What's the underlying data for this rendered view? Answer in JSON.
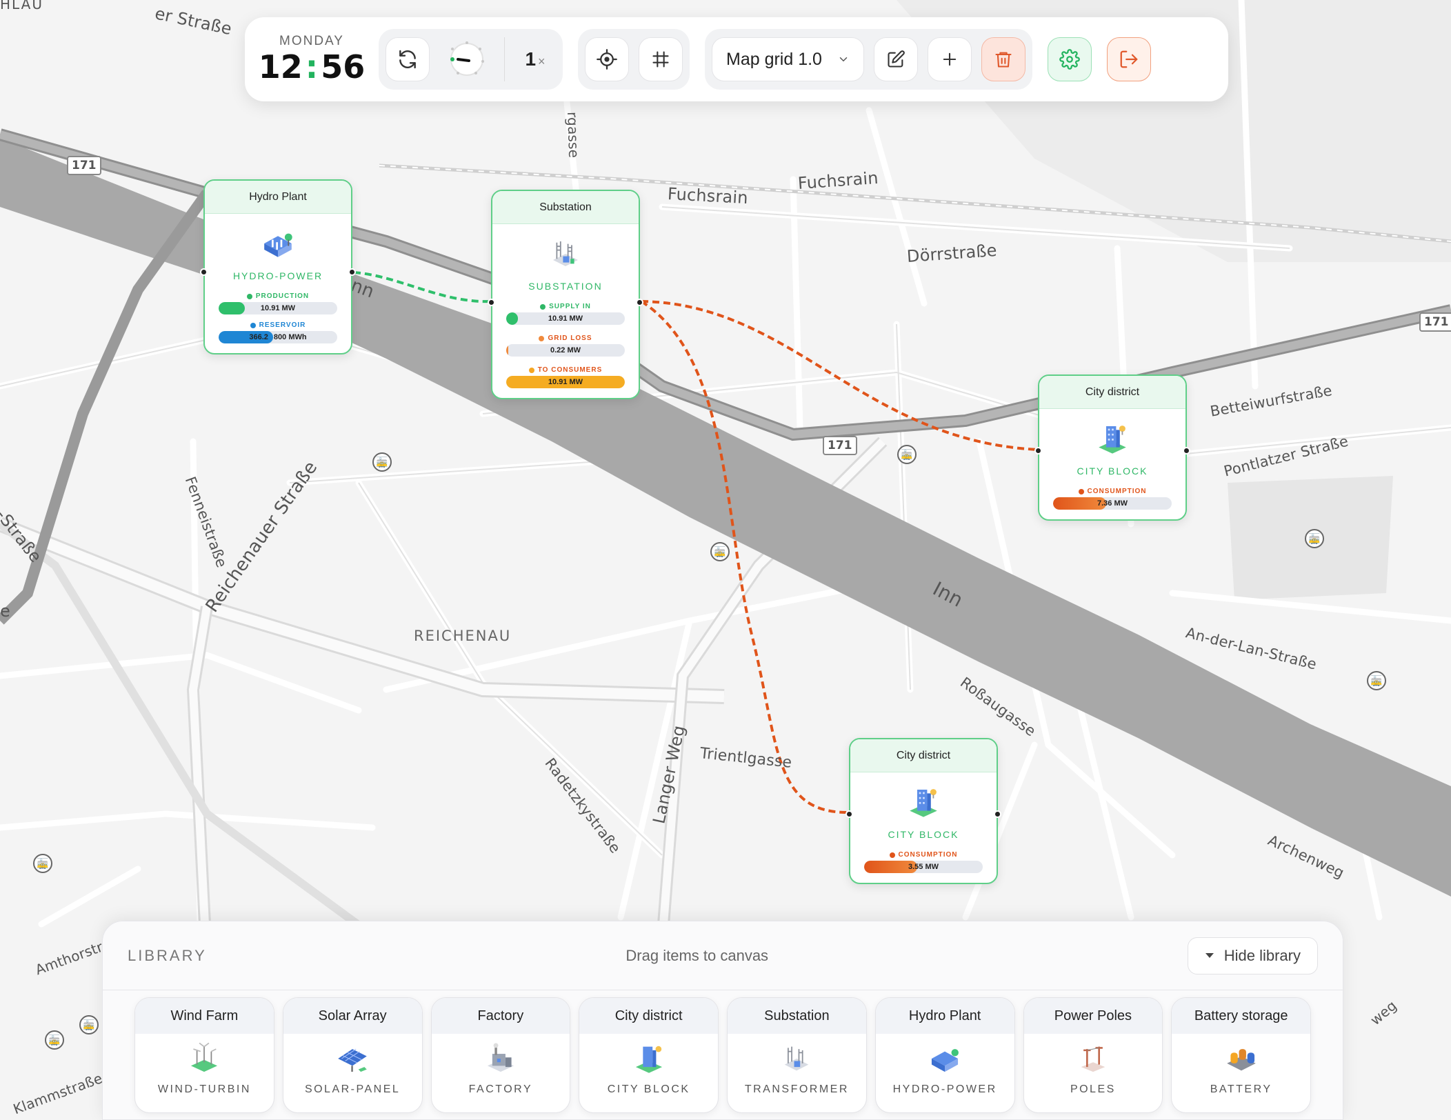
{
  "map": {
    "labels": {
      "reichenau": "REICHENAU",
      "inn": "Inn",
      "inn_small": "nn",
      "fuchsrain1": "Fuchsrain",
      "fuchsrain2": "Fuchsrain",
      "doerrstrasse": "Dörrstraße",
      "betteiwurfstrasse": "Betteiwurfstraße",
      "pontlatzer": "Pontlatzer Straße",
      "reichenauer": "Reichenauer Straße",
      "fenneistrasse": "Fenneistraße",
      "radetzky": "Radetzkystraße",
      "langerweg": "Langer Weg",
      "trientlgasse": "Trientlgasse",
      "rossaugasse": "Roßaugasse",
      "anderlan": "An-der-Lan-Straße",
      "archenweg": "Archenweg",
      "amthor": "Amthorstr",
      "klammstrasse": "Klammstraße",
      "ergasse": "rgasse",
      "erstrasse": "er Straße",
      "hlau": "HLAU",
      "strasse_left": "-Straße",
      "weg_right": "weg",
      "e_left": "e"
    },
    "shields": [
      "171",
      "171",
      "171"
    ]
  },
  "toolbar": {
    "day": "MONDAY",
    "hour": "12",
    "colon": ":",
    "minute": "56",
    "speed_value": "1",
    "speed_unit": "×",
    "map_select": "Map grid 1.0"
  },
  "nodes": {
    "hydro": {
      "title": "Hydro Plant",
      "type": "HYDRO-POWER",
      "m1_label": "PRODUCTION",
      "m1_value": "10.91 MW",
      "m1_fill": 0.22,
      "m2_label": "RESERVOIR",
      "m2_value_a": "366.2",
      "m2_value_b": "800 MWh",
      "m2_fill": 0.46
    },
    "substation": {
      "title": "Substation",
      "type": "SUBSTATION",
      "m1_label": "SUPPLY IN",
      "m1_value": "10.91 MW",
      "m1_fill": 0.1,
      "m2_label": "GRID LOSS",
      "m2_value": "0.22 MW",
      "m2_fill": 0.02,
      "m3_label": "TO CONSUMERS",
      "m3_value": "10.91 MW",
      "m3_fill": 1.0
    },
    "city1": {
      "title": "City district",
      "type": "CITY BLOCK",
      "m1_label": "CONSUMPTION",
      "m1_value": "7.36 MW",
      "m1_fill": 0.45
    },
    "city2": {
      "title": "City district",
      "type": "CITY BLOCK",
      "m1_label": "CONSUMPTION",
      "m1_value": "3.55 MW",
      "m1_fill": 0.45
    }
  },
  "library": {
    "title": "LIBRARY",
    "hint": "Drag items to canvas",
    "hide_label": "Hide library",
    "items": [
      {
        "name": "Wind Farm",
        "sub": "WIND-TURBIN"
      },
      {
        "name": "Solar Array",
        "sub": "SOLAR-PANEL"
      },
      {
        "name": "Factory",
        "sub": "FACTORY"
      },
      {
        "name": "City district",
        "sub": "CITY BLOCK"
      },
      {
        "name": "Substation",
        "sub": "TRANSFORMER"
      },
      {
        "name": "Hydro Plant",
        "sub": "HYDRO-POWER"
      },
      {
        "name": "Power Poles",
        "sub": "POLES"
      },
      {
        "name": "Battery storage",
        "sub": "BATTERY"
      }
    ]
  },
  "colors": {
    "accent_green": "#22b35e",
    "danger": "#e0582b",
    "link_green": "#2fbf6b",
    "link_orange": "#e0541a",
    "water": "#a9a9a9"
  }
}
